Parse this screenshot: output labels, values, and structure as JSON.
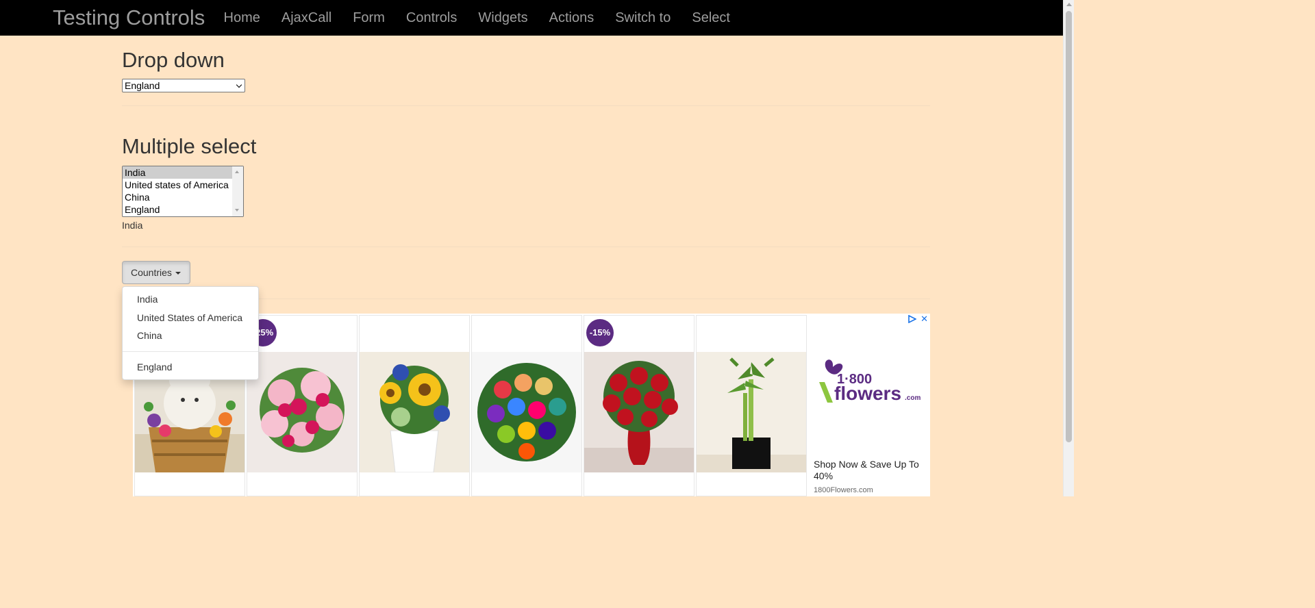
{
  "navbar": {
    "brand": "Testing Controls",
    "links": [
      "Home",
      "AjaxCall",
      "Form",
      "Controls",
      "Widgets",
      "Actions",
      "Switch to",
      "Select"
    ]
  },
  "dropdown_section": {
    "title": "Drop down",
    "selected": "England"
  },
  "multiple_section": {
    "title": "Multiple select",
    "options": [
      "India",
      "United states of America",
      "China",
      "England"
    ],
    "selected": "India",
    "result": "India"
  },
  "countries_button": {
    "label": "Countries",
    "menu": [
      "India",
      "United States of America",
      "China",
      "England"
    ]
  },
  "ad": {
    "badges": [
      "-25%",
      "-15%"
    ],
    "logo_text": "1·800 flowers.com",
    "headline": "Shop Now & Save Up To 40%",
    "domain": "1800Flowers.com",
    "close": "✕"
  },
  "colors": {
    "page_bg": "#ffe4c4",
    "navbar_bg": "#000000",
    "nav_text": "#9d9d9d",
    "badge": "#5b2b82"
  }
}
